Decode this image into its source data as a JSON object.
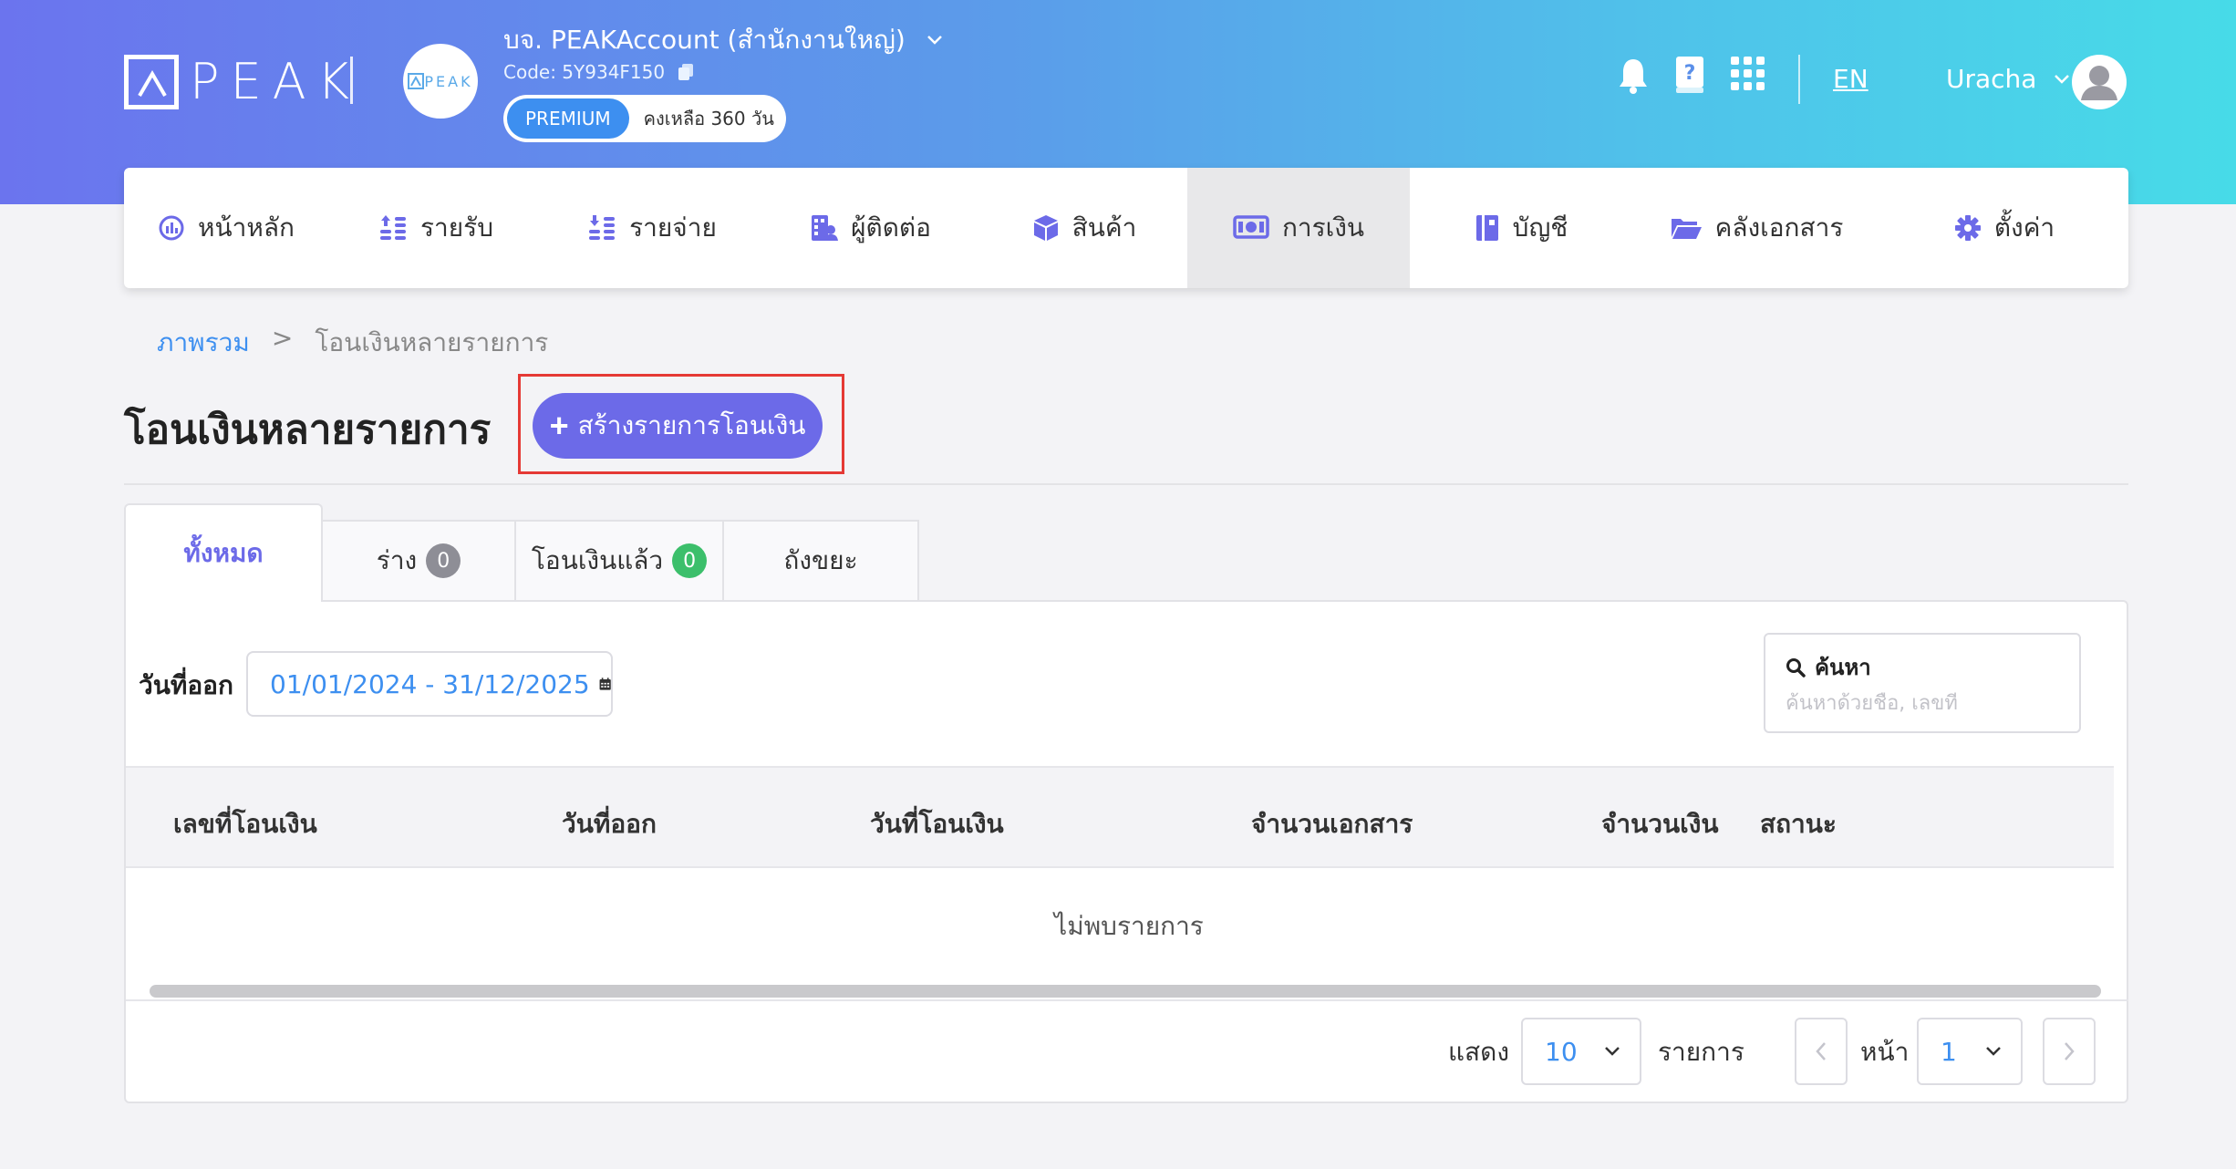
{
  "brand": {
    "logo_text": "PEAK",
    "company_avatar_text": "PEAK"
  },
  "company": {
    "name": "บจ. PEAKAccount (สำนักงานใหญ่)",
    "code": "Code: 5Y934F150",
    "plan": "PREMIUM",
    "remaining": "คงเหลือ 360 วัน"
  },
  "header": {
    "language": "EN",
    "user": "Uracha"
  },
  "menu": [
    {
      "label": "หน้าหลัก",
      "icon": "dashboard-icon"
    },
    {
      "label": "รายรับ",
      "icon": "income-icon"
    },
    {
      "label": "รายจ่าย",
      "icon": "expense-icon"
    },
    {
      "label": "ผู้ติดต่อ",
      "icon": "contacts-icon"
    },
    {
      "label": "สินค้า",
      "icon": "product-box-icon"
    },
    {
      "label": "การเงิน",
      "icon": "money-icon",
      "active": true
    },
    {
      "label": "บัญชี",
      "icon": "ledger-book-icon"
    },
    {
      "label": "คลังเอกสาร",
      "icon": "folder-icon"
    },
    {
      "label": "ตั้งค่า",
      "icon": "gear-icon"
    }
  ],
  "breadcrumb": {
    "home": "ภาพรวม",
    "separator": ">",
    "current": "โอนเงินหลายรายการ"
  },
  "page": {
    "title": "โอนเงินหลายรายการ",
    "create_button": "สร้างรายการโอนเงิน"
  },
  "tabs": [
    {
      "label": "ทั้งหมด",
      "active": true
    },
    {
      "label": "ร่าง",
      "count": "0",
      "count_color": "#8e8e96"
    },
    {
      "label": "โอนเงินแล้ว",
      "count": "0",
      "count_color": "#3cbf6b"
    },
    {
      "label": "ถังขยะ"
    }
  ],
  "filter": {
    "date_label": "วันที่ออก",
    "date_range": "01/01/2024 - 31/12/2025"
  },
  "search": {
    "label": "ค้นหา",
    "placeholder": "ค้นหาด้วยชื่อ, เลขที่"
  },
  "table": {
    "columns": [
      "เลขที่โอนเงิน",
      "วันที่ออก",
      "วันที่โอนเงิน",
      "จำนวนเอกสาร",
      "จำนวนเงิน",
      "สถานะ"
    ],
    "empty": "ไม่พบรายการ"
  },
  "pagination": {
    "show_label": "แสดง",
    "per_page": "10",
    "items_label": "รายการ",
    "page_label": "หน้า",
    "page": "1"
  },
  "colors": {
    "accent": "#6c6ae8",
    "link": "#3d8ff0",
    "highlight": "#e53935"
  }
}
